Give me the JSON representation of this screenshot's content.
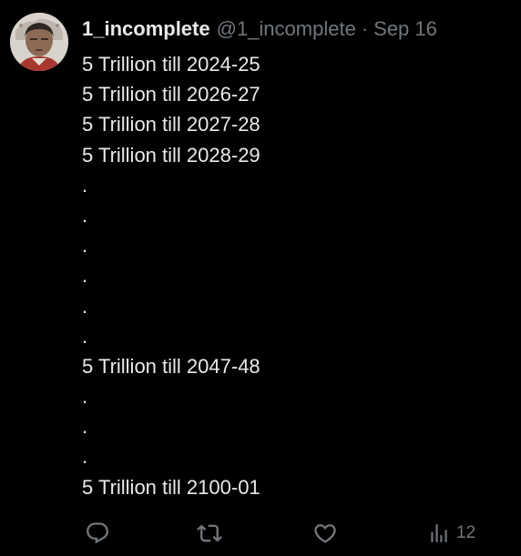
{
  "tweet": {
    "display_name": "1_incomplete",
    "handle": "@1_incomplete",
    "separator": "·",
    "date": "Sep 16",
    "lines": [
      "5 Trillion till 2024-25",
      "5 Trillion till 2026-27",
      "5 Trillion till 2027-28",
      "5 Trillion till 2028-29",
      ".",
      ".",
      ".",
      ".",
      ".",
      ".",
      "5 Trillion till 2047-48",
      ".",
      ".",
      ".",
      "5 Trillion till 2100-01"
    ]
  },
  "actions": {
    "reply_icon": "reply-icon",
    "retweet_icon": "retweet-icon",
    "like_icon": "heart-icon",
    "views_icon": "views-icon",
    "views_count": "12"
  },
  "colors": {
    "background": "#000000",
    "primary_text": "#e7e9ea",
    "secondary_text": "#71767b"
  }
}
